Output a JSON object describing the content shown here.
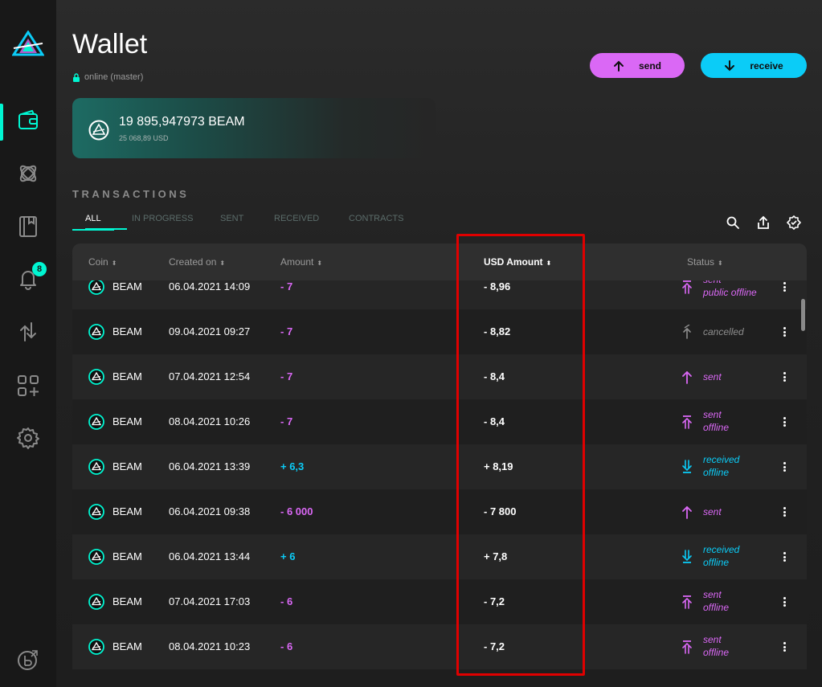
{
  "sidebar": {
    "notifications_badge": "8",
    "items": [
      {
        "name": "wallet",
        "active": true
      },
      {
        "name": "atom"
      },
      {
        "name": "address-book"
      },
      {
        "name": "notifications"
      },
      {
        "name": "transfers"
      },
      {
        "name": "apps"
      },
      {
        "name": "settings"
      }
    ]
  },
  "header": {
    "title": "Wallet",
    "status": "online (master)",
    "send_label": "send",
    "receive_label": "receive"
  },
  "balance": {
    "amount": "19 895,947973  BEAM",
    "usd": "25 068,89 USD"
  },
  "transactions": {
    "title": "TRANSACTIONS",
    "tabs": [
      "ALL",
      "IN PROGRESS",
      "SENT",
      "RECEIVED",
      "CONTRACTS"
    ],
    "columns": {
      "coin": "Coin",
      "created": "Created on",
      "amount": "Amount",
      "usd": "USD Amount",
      "status": "Status"
    },
    "rows": [
      {
        "coin": "BEAM",
        "date": "06.04.2021 14:09",
        "amount": "- 7",
        "usd": "- 8,96",
        "status1": "sent",
        "status2": "public offline",
        "kind": "sent-public"
      },
      {
        "coin": "BEAM",
        "date": "09.04.2021 09:27",
        "amount": "- 7",
        "usd": "- 8,82",
        "status1": "cancelled",
        "status2": "",
        "kind": "cancelled"
      },
      {
        "coin": "BEAM",
        "date": "07.04.2021 12:54",
        "amount": "- 7",
        "usd": "- 8,4",
        "status1": "sent",
        "status2": "",
        "kind": "sent"
      },
      {
        "coin": "BEAM",
        "date": "08.04.2021 10:26",
        "amount": "- 7",
        "usd": "- 8,4",
        "status1": "sent",
        "status2": "offline",
        "kind": "sent-offline"
      },
      {
        "coin": "BEAM",
        "date": "06.04.2021 13:39",
        "amount": "+ 6,3",
        "usd": "+ 8,19",
        "status1": "received",
        "status2": "offline",
        "kind": "received-offline"
      },
      {
        "coin": "BEAM",
        "date": "06.04.2021 09:38",
        "amount": "- 6 000",
        "usd": "- 7 800",
        "status1": "sent",
        "status2": "",
        "kind": "sent"
      },
      {
        "coin": "BEAM",
        "date": "06.04.2021 13:44",
        "amount": "+ 6",
        "usd": "+ 7,8",
        "status1": "received",
        "status2": "offline",
        "kind": "received-offline"
      },
      {
        "coin": "BEAM",
        "date": "07.04.2021 17:03",
        "amount": "- 6",
        "usd": "- 7,2",
        "status1": "sent",
        "status2": "offline",
        "kind": "sent-offline"
      },
      {
        "coin": "BEAM",
        "date": "08.04.2021 10:23",
        "amount": "- 6",
        "usd": "- 7,2",
        "status1": "sent",
        "status2": "offline",
        "kind": "sent-offline"
      }
    ]
  },
  "colors": {
    "accent": "#00f6d2",
    "send": "#da68f5",
    "receive": "#0bccf7",
    "highlight": "#e00000"
  }
}
